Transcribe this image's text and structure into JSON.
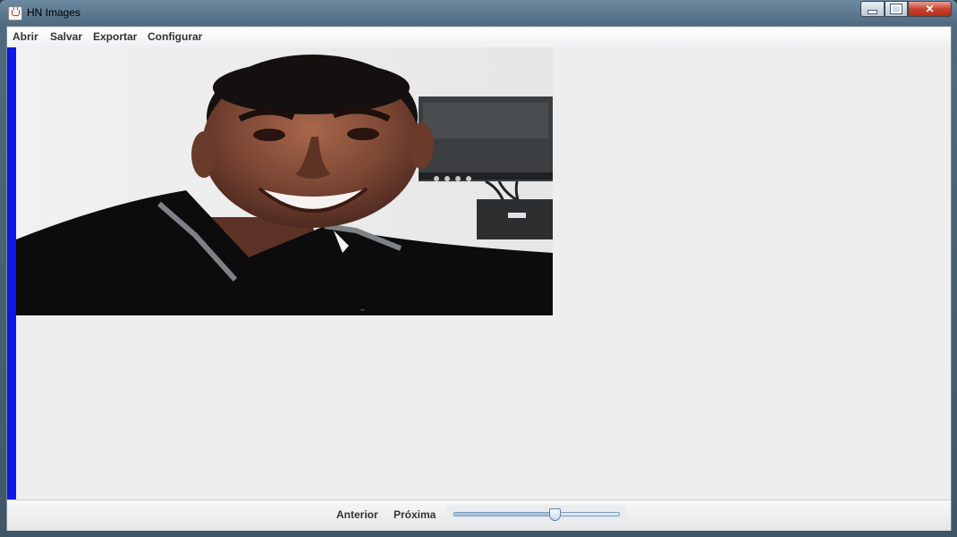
{
  "window": {
    "title": "HN Images"
  },
  "menu": {
    "items": [
      {
        "label": "Abrir"
      },
      {
        "label": "Salvar"
      },
      {
        "label": "Exportar"
      },
      {
        "label": "Configurar"
      }
    ]
  },
  "viewer": {
    "accent": "#0b18e6",
    "image_subject": "portrait photo of smiling man in black polo shirt"
  },
  "navigation": {
    "previous_label": "Anterior",
    "next_label": "Próxima",
    "slider_value_fraction": 0.61
  },
  "icons": [
    "java-cup-icon",
    "minimize-icon",
    "maximize-icon",
    "close-icon"
  ]
}
